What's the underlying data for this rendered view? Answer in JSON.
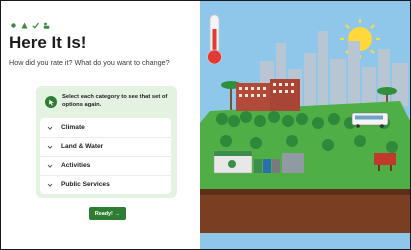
{
  "header": {
    "icons": [
      "sun-icon",
      "tree-icon",
      "check-icon",
      "person-icon"
    ],
    "title": "Here It Is!",
    "subtitle": "How did you rate it? What do you want to change?"
  },
  "panel": {
    "hint": "Select each category to see that set of options again.",
    "categories": [
      {
        "label": "Climate"
      },
      {
        "label": "Land & Water"
      },
      {
        "label": "Activities"
      },
      {
        "label": "Public Services"
      }
    ]
  },
  "footer": {
    "ready_label": "Ready!",
    "ready_arrow": "→"
  },
  "colors": {
    "accent": "#2e7d32",
    "panel_bg": "#e4f2e2",
    "sky": "#8ec7ea",
    "soil": "#7a3f22"
  }
}
